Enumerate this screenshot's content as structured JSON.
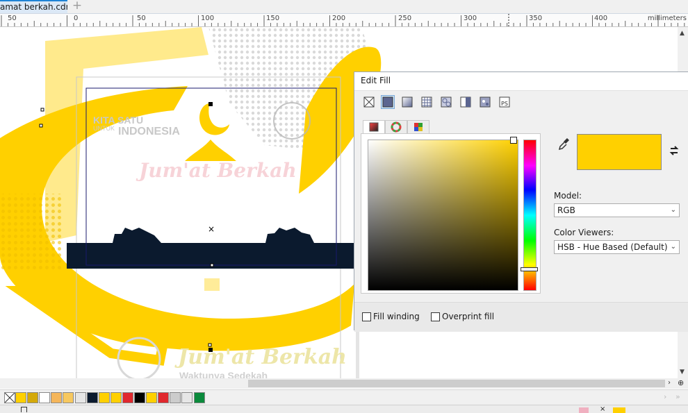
{
  "document_tab": {
    "title": "amat berkah.cdr",
    "new_tab_symbol": "+"
  },
  "ruler": {
    "labels": [
      "50",
      "0",
      "50",
      "100",
      "150",
      "200",
      "250",
      "300",
      "350",
      "400"
    ],
    "unit": "millimeters"
  },
  "artwork": {
    "top_text_line1": "KITA SATU",
    "top_text_small": "UNTUK",
    "top_text_line2": "INDONESIA",
    "watermark_bottom": "Jum'at Berkah",
    "watermark_sub": "Waktunya Sedekah",
    "mid_watermark": "Jum'at Berkah",
    "colors": {
      "yellow": "#FFD000",
      "navy": "#0B1A2E"
    }
  },
  "edit_fill": {
    "title": "Edit Fill",
    "fill_types": [
      "no-fill-icon",
      "uniform-fill-icon",
      "fountain-fill-icon",
      "vector-pattern-icon",
      "bitmap-pattern-icon",
      "two-color-pattern-icon",
      "texture-fill-icon",
      "postscript-fill-icon"
    ],
    "viewer_tabs": [
      "color-viewers-tab",
      "color-harmonies-tab",
      "color-palettes-tab"
    ],
    "current_color": "#FFD000",
    "model_label": "Model:",
    "model_value": "RGB",
    "viewers_label": "Color Viewers:",
    "viewers_value": "HSB - Hue Based (Default)",
    "fill_winding": "Fill winding",
    "overprint_fill": "Overprint fill"
  },
  "palette": {
    "colors": [
      "#FFD000",
      "#D4A90A",
      "#FFFFFF",
      "#F5B65A",
      "#F7C85F",
      "#E6E6E6",
      "#0B1A2E",
      "#FFD000",
      "#FFD000",
      "#E0282E",
      "#000000",
      "#FFD000",
      "#E0282E",
      "#CCCCCC",
      "#E6E6E6",
      "#0B8A3C"
    ]
  }
}
